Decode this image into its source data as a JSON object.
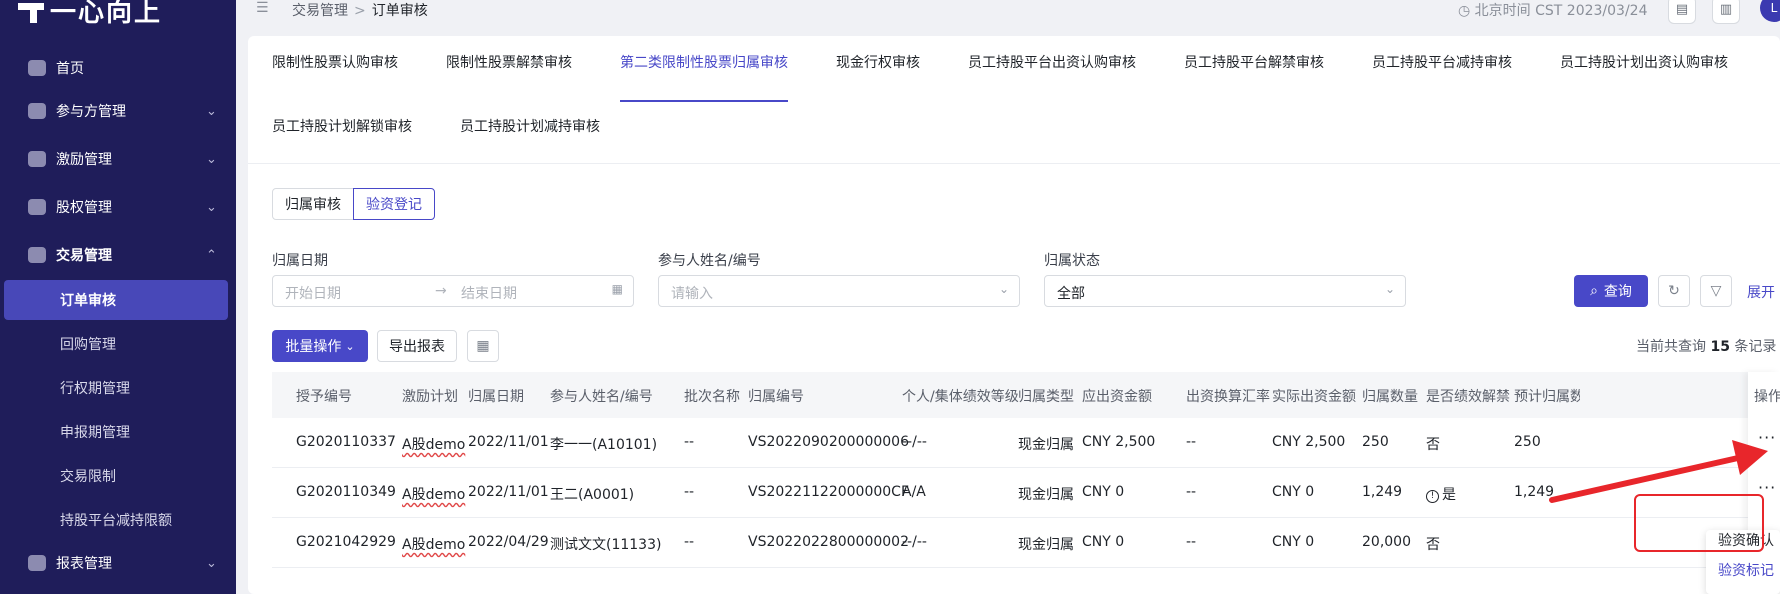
{
  "app": {
    "logo_text": "一心向上"
  },
  "sidebar": {
    "items": [
      {
        "label": "首页",
        "icon": "home-icon"
      },
      {
        "label": "参与方管理",
        "icon": "users-icon",
        "expand": "⌄"
      },
      {
        "label": "激励管理",
        "icon": "star-icon",
        "expand": "⌄"
      },
      {
        "label": "股权管理",
        "icon": "equity-icon",
        "expand": "⌄"
      },
      {
        "label": "交易管理",
        "icon": "trade-icon",
        "expand": "⌃"
      }
    ],
    "sub_items": [
      "订单审核",
      "回购管理",
      "行权期管理",
      "申报期管理",
      "交易限制",
      "持股平台减持限额"
    ],
    "after": {
      "label": "报表管理",
      "icon": "report-icon",
      "expand": "⌄"
    }
  },
  "header": {
    "breadcrumb": [
      "交易管理",
      "订单审核"
    ],
    "breadcrumb_sep": ">",
    "clock": "北京时间 CST 2023/03/24",
    "avatar": "L"
  },
  "tabs": [
    "限制性股票认购审核",
    "限制性股票解禁审核",
    "第二类限制性股票归属审核",
    "现金行权审核",
    "员工持股平台出资认购审核",
    "员工持股平台解禁审核",
    "员工持股平台减持审核",
    "员工持股计划出资认购审核",
    "员工持股计划解锁审核",
    "员工持股计划减持审核"
  ],
  "active_tab_index": 2,
  "segment": {
    "left": "归属审核",
    "right": "验资登记",
    "active": "验资登记"
  },
  "filters": {
    "date_label": "归属日期",
    "date_start_placeholder": "开始日期",
    "date_arrow": "→",
    "date_end_placeholder": "结束日期",
    "name_label": "参与人姓名/编号",
    "name_placeholder": "请输入",
    "status_label": "归属状态",
    "status_value": "全部",
    "query_label": "查询",
    "expand_label": "展开"
  },
  "toolbar": {
    "batch_label": "批量操作",
    "export_label": "导出报表",
    "summary_prefix": "当前共查询",
    "summary_count": "15",
    "summary_suffix": "条记录"
  },
  "table": {
    "columns": [
      "授予编号",
      "激励计划",
      "归属日期",
      "参与人姓名/编号",
      "批次名称",
      "归属编号",
      "个人/集体绩效等级",
      "归属类型",
      "应出资金额",
      "出资换算汇率",
      "实际出资金额",
      "归属数量",
      "是否绩效解禁",
      "预计归属数",
      "操作"
    ],
    "rows": [
      [
        "G2020110337",
        "A股demo",
        "2022/11/01",
        "李一一(A10101)",
        "--",
        "VS2022090200000006",
        "--/--",
        "现金归属",
        "CNY 2,500",
        "--",
        "CNY 2,500",
        "250",
        "否",
        "250"
      ],
      [
        "G2020110349",
        "A股demo",
        "2022/11/01",
        "王二(A0001)",
        "--",
        "VS20221122000000CF",
        "A/A",
        "现金归属",
        "CNY 0",
        "--",
        "CNY 0",
        "1,249",
        "是",
        "1,249"
      ],
      [
        "G2021042929",
        "A股demo",
        "2022/04/29",
        "测试文文(11133)",
        "--",
        "VS2022022800000002",
        "--/--",
        "现金归属",
        "CNY 0",
        "--",
        "CNY 0",
        "20,000",
        "否",
        ""
      ]
    ],
    "more_label": "···"
  },
  "dropdown_menu": [
    "验资确认",
    "验资标记"
  ],
  "colors": {
    "sidebar": "#1f1d5a",
    "accent": "#4848c8",
    "annotation": "#e8262b"
  }
}
